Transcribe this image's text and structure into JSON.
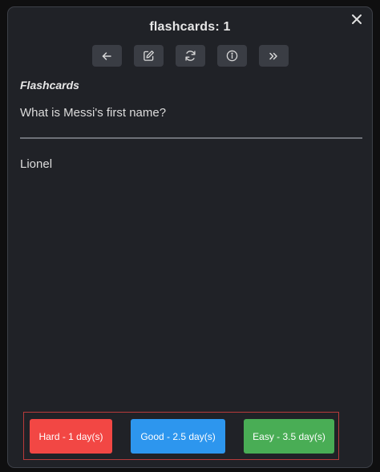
{
  "modal": {
    "title": "flashcards: 1",
    "close_icon": "close-icon"
  },
  "toolbar": {
    "buttons": [
      {
        "name": "back",
        "icon": "arrow-left-icon"
      },
      {
        "name": "edit",
        "icon": "edit-icon"
      },
      {
        "name": "reset",
        "icon": "refresh-icon"
      },
      {
        "name": "info",
        "icon": "info-icon"
      },
      {
        "name": "skip",
        "icon": "double-chevron-right-icon"
      }
    ]
  },
  "card": {
    "heading": "Flashcards",
    "question": "What is Messi's first name?",
    "answer": "Lionel"
  },
  "rating": {
    "hard_label": "Hard - 1 day(s)",
    "good_label": "Good - 2.5 day(s)",
    "easy_label": "Easy - 3.5 day(s)",
    "colors": {
      "hard": "#f24744",
      "good": "#2d96ee",
      "easy": "#49ad55",
      "highlight_border": "#b83b3b"
    }
  }
}
